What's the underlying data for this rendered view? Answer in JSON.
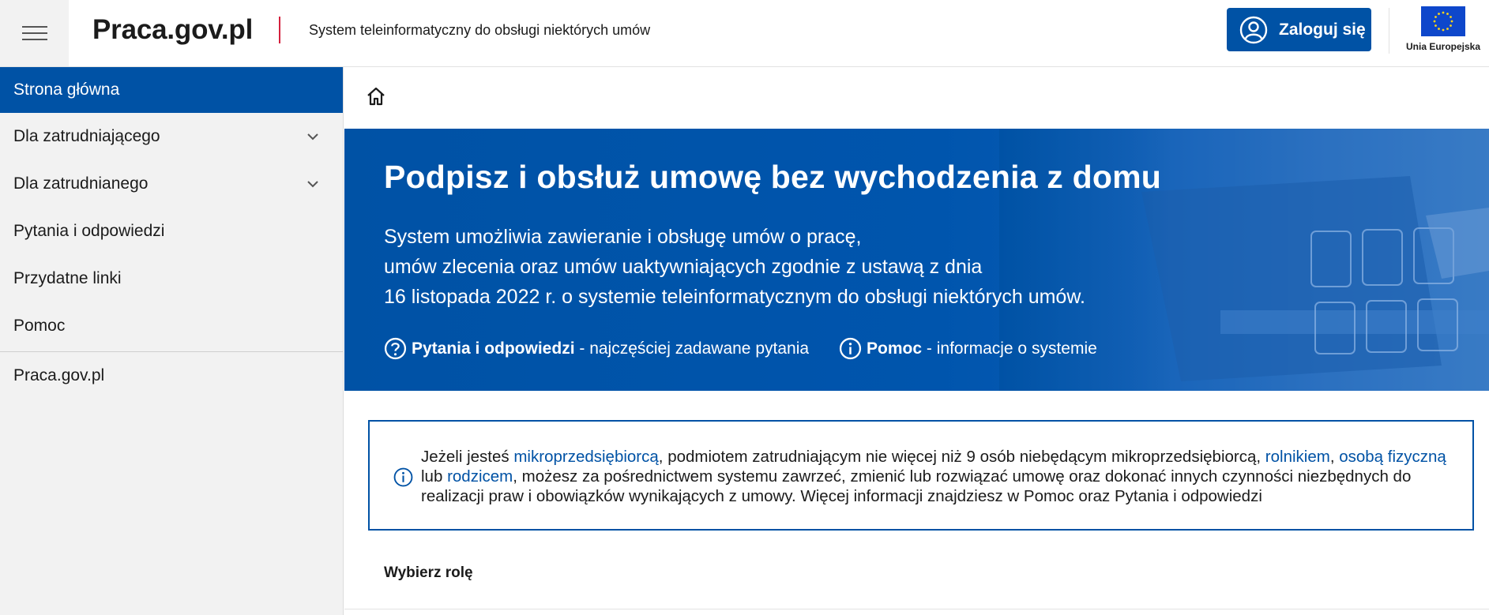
{
  "header": {
    "brand": "Praca.gov.pl",
    "subtitle": "System teleinformatyczny do obsługi niektórych umów",
    "login_label": "Zaloguj się",
    "eu_label": "Unia Europejska",
    "menu_icon": "hamburger-icon",
    "login_icon": "user-icon",
    "eu_icon": "eu-flag-icon"
  },
  "sidebar": {
    "items": [
      {
        "label": "Strona główna",
        "active": true
      },
      {
        "label": "Dla zatrudniającego",
        "expandable": true
      },
      {
        "label": "Dla zatrudnianego",
        "expandable": true
      },
      {
        "label": "Pytania i odpowiedzi"
      },
      {
        "label": "Przydatne linki"
      },
      {
        "label": "Pomoc"
      }
    ],
    "external": "Praca.gov.pl"
  },
  "hero": {
    "title": "Podpisz i obsłuż umowę bez wychodzenia z domu",
    "desc_lines": [
      "System umożliwia zawieranie i obsługę umów o pracę,",
      "umów zlecenia oraz umów uaktywniających zgodnie z ustawą z dnia",
      "16 listopada 2022 r. o systemie teleinformatycznym do obsługi niektórych umów."
    ],
    "link_faq_bold": "Pytania i odpowiedzi",
    "link_faq_rest": " - najczęściej zadawane pytania",
    "link_help_bold": "Pomoc",
    "link_help_rest": " - informacje o systemie"
  },
  "info": {
    "t1": "Jeżeli jesteś ",
    "l1": "mikroprzedsiębiorcą",
    "t2": ", podmiotem zatrudniającym nie więcej niż 9 osób niebędącym mikroprzedsiębiorcą, ",
    "l2": "rolnikiem",
    "t3": ", ",
    "l3": "osobą fizyczną",
    "t4": " lub ",
    "l4": "rodzicem",
    "t5": ", możesz za pośrednictwem systemu zawrzeć, zmienić lub rozwiązać umowę oraz dokonać innych czynności niezbędnych do realizacji praw i obowiązków wynikających z umowy. Więcej informacji znajdziesz w Pomoc oraz Pytania i odpowiedzi"
  },
  "role_heading": "Wybierz rolę",
  "colors": {
    "primary": "#0052a5",
    "accent_red": "#d4213d",
    "sidebar_bg": "#f2f2f2"
  }
}
